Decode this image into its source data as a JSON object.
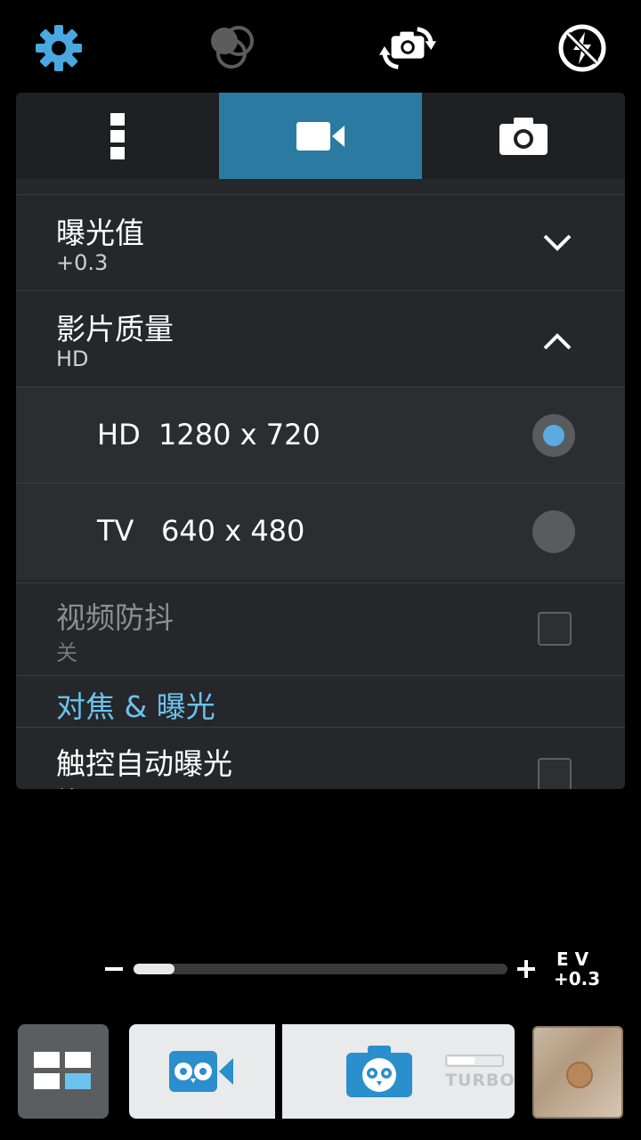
{
  "topbar": {
    "icons": [
      "gear-icon",
      "color-effect-icon",
      "switch-camera-icon",
      "flash-off-icon"
    ]
  },
  "tabs": [
    {
      "name": "tab-more",
      "icon": "more-vert-icon"
    },
    {
      "name": "tab-video",
      "icon": "video-camera-icon",
      "active": true
    },
    {
      "name": "tab-photo",
      "icon": "photo-camera-icon"
    }
  ],
  "settings": {
    "exposure": {
      "title": "曝光值",
      "value": "+0.3"
    },
    "video_quality": {
      "title": "影片质量",
      "value": "HD",
      "options": [
        {
          "label": "HD  1280 x 720",
          "selected": true
        },
        {
          "label": "TV   640 x 480",
          "selected": false
        }
      ]
    },
    "stabilization": {
      "title": "视频防抖",
      "value": "关",
      "checked": false,
      "enabled": false
    },
    "section_focus": "对焦 & 曝光",
    "touch_auto_exposure": {
      "title": "触控自动曝光",
      "value": "关",
      "checked": false
    }
  },
  "ev_slider": {
    "label_top": "E V",
    "label_value": "+0.3",
    "level": 0.08
  },
  "bottom": {
    "turbo_label": "TURBO",
    "accent": "#2a7aa1",
    "selection_blue": "#5aace0",
    "section_blue": "#6cc2ee"
  }
}
